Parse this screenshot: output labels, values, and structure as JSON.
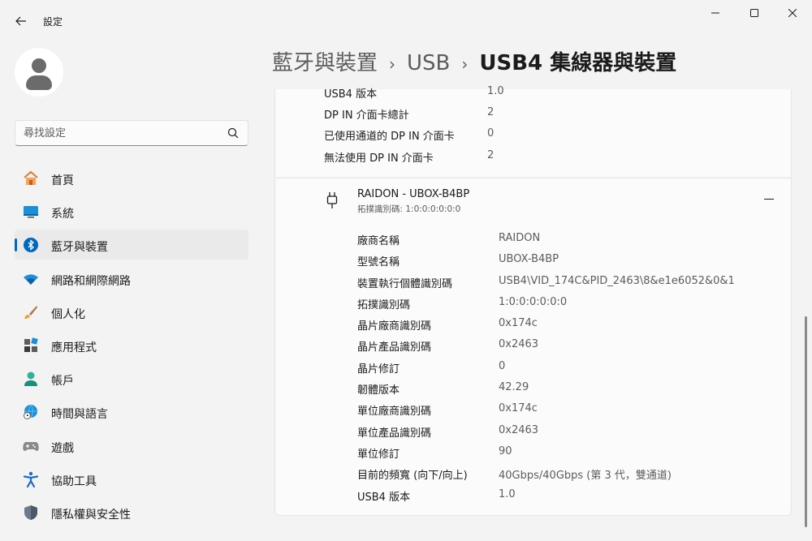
{
  "app": {
    "title": "設定",
    "icons": {
      "back": "arrow-left-icon",
      "minimize": "minimize-icon",
      "maximize": "maximize-icon",
      "close": "close-icon"
    }
  },
  "search": {
    "placeholder": "尋找設定"
  },
  "sidebar": {
    "items": [
      {
        "label": "首頁",
        "icon": "home-icon"
      },
      {
        "label": "系統",
        "icon": "monitor-icon"
      },
      {
        "label": "藍牙與裝置",
        "icon": "bluetooth-icon",
        "selected": true
      },
      {
        "label": "網路和網際網路",
        "icon": "wifi-icon"
      },
      {
        "label": "個人化",
        "icon": "brush-icon"
      },
      {
        "label": "應用程式",
        "icon": "apps-icon"
      },
      {
        "label": "帳戶",
        "icon": "person-icon"
      },
      {
        "label": "時間與語言",
        "icon": "globe-clock-icon"
      },
      {
        "label": "遊戲",
        "icon": "gamepad-icon"
      },
      {
        "label": "協助工具",
        "icon": "accessibility-icon"
      },
      {
        "label": "隱私權與安全性",
        "icon": "shield-icon"
      }
    ]
  },
  "breadcrumb": {
    "items": [
      "藍牙與裝置",
      "USB",
      "USB4 集線器與裝置"
    ],
    "separator": "›"
  },
  "top_card": {
    "rows": [
      {
        "label": "USB4 版本",
        "value": "1.0"
      },
      {
        "label": "DP IN 介面卡總計",
        "value": "2"
      },
      {
        "label": "已使用通道的 DP IN 介面卡",
        "value": "0"
      },
      {
        "label": "無法使用 DP IN 介面卡",
        "value": "2"
      }
    ]
  },
  "device": {
    "name": "RAIDON - UBOX-B4BP",
    "subtitle": "拓撲識別碼: 1:0:0:0:0:0:0",
    "icon": "usb-plug-icon",
    "properties": [
      {
        "label": "廠商名稱",
        "value": "RAIDON"
      },
      {
        "label": "型號名稱",
        "value": "UBOX-B4BP"
      },
      {
        "label": "裝置執行個體識別碼",
        "value": "USB4\\VID_174C&PID_2463\\8&e1e6052&0&1"
      },
      {
        "label": "拓撲識別碼",
        "value": "1:0:0:0:0:0:0"
      },
      {
        "label": "晶片廠商識別碼",
        "value": "0x174c"
      },
      {
        "label": "晶片產品識別碼",
        "value": "0x2463"
      },
      {
        "label": "晶片修訂",
        "value": "0"
      },
      {
        "label": "韌體版本",
        "value": "42.29"
      },
      {
        "label": "單位廠商識別碼",
        "value": "0x174c"
      },
      {
        "label": "單位產品識別碼",
        "value": "0x2463"
      },
      {
        "label": "單位修訂",
        "value": "90"
      },
      {
        "label": "目前的頻寬 (向下/向上)",
        "value": "40Gbps/40Gbps (第 3 代，雙通道)"
      },
      {
        "label": "USB4 版本",
        "value": "1.0"
      }
    ]
  },
  "colors": {
    "accent": "#0067c0",
    "background": "#f3f3f3",
    "card": "#fbfbfb"
  }
}
